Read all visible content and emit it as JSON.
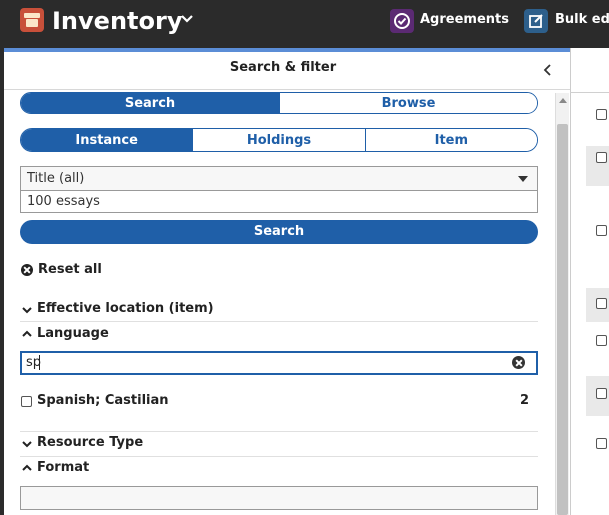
{
  "app": {
    "title": "Inventory",
    "links": [
      {
        "label": "Agreements",
        "icon": "agreements-icon",
        "color": "#5b2a73"
      },
      {
        "label": "Bulk edi",
        "icon": "bulk-edit-icon",
        "color": "#2d5f8b"
      }
    ]
  },
  "pane": {
    "title": "Search & filter"
  },
  "navigation": {
    "tabs": [
      "Search",
      "Browse"
    ],
    "active": "Search"
  },
  "segments": {
    "tabs": [
      "Instance",
      "Holdings",
      "Item"
    ],
    "active": "Instance"
  },
  "search": {
    "index_selected": "Title (all)",
    "query": "100 essays",
    "button_label": "Search"
  },
  "reset": {
    "label": "Reset all"
  },
  "filters": {
    "effective_location": {
      "label": "Effective location (item)",
      "expanded": false
    },
    "language": {
      "label": "Language",
      "expanded": true,
      "search_value": "sp",
      "options": [
        {
          "label": "Spanish; Castilian",
          "count": "2",
          "checked": false
        }
      ]
    },
    "resource_type": {
      "label": "Resource Type",
      "expanded": false
    },
    "format": {
      "label": "Format",
      "expanded": true,
      "search_value": ""
    }
  },
  "colors": {
    "primary": "#1f5fa8",
    "topbar": "#2b2b2b",
    "pane_accent": "#5b8dd6"
  }
}
